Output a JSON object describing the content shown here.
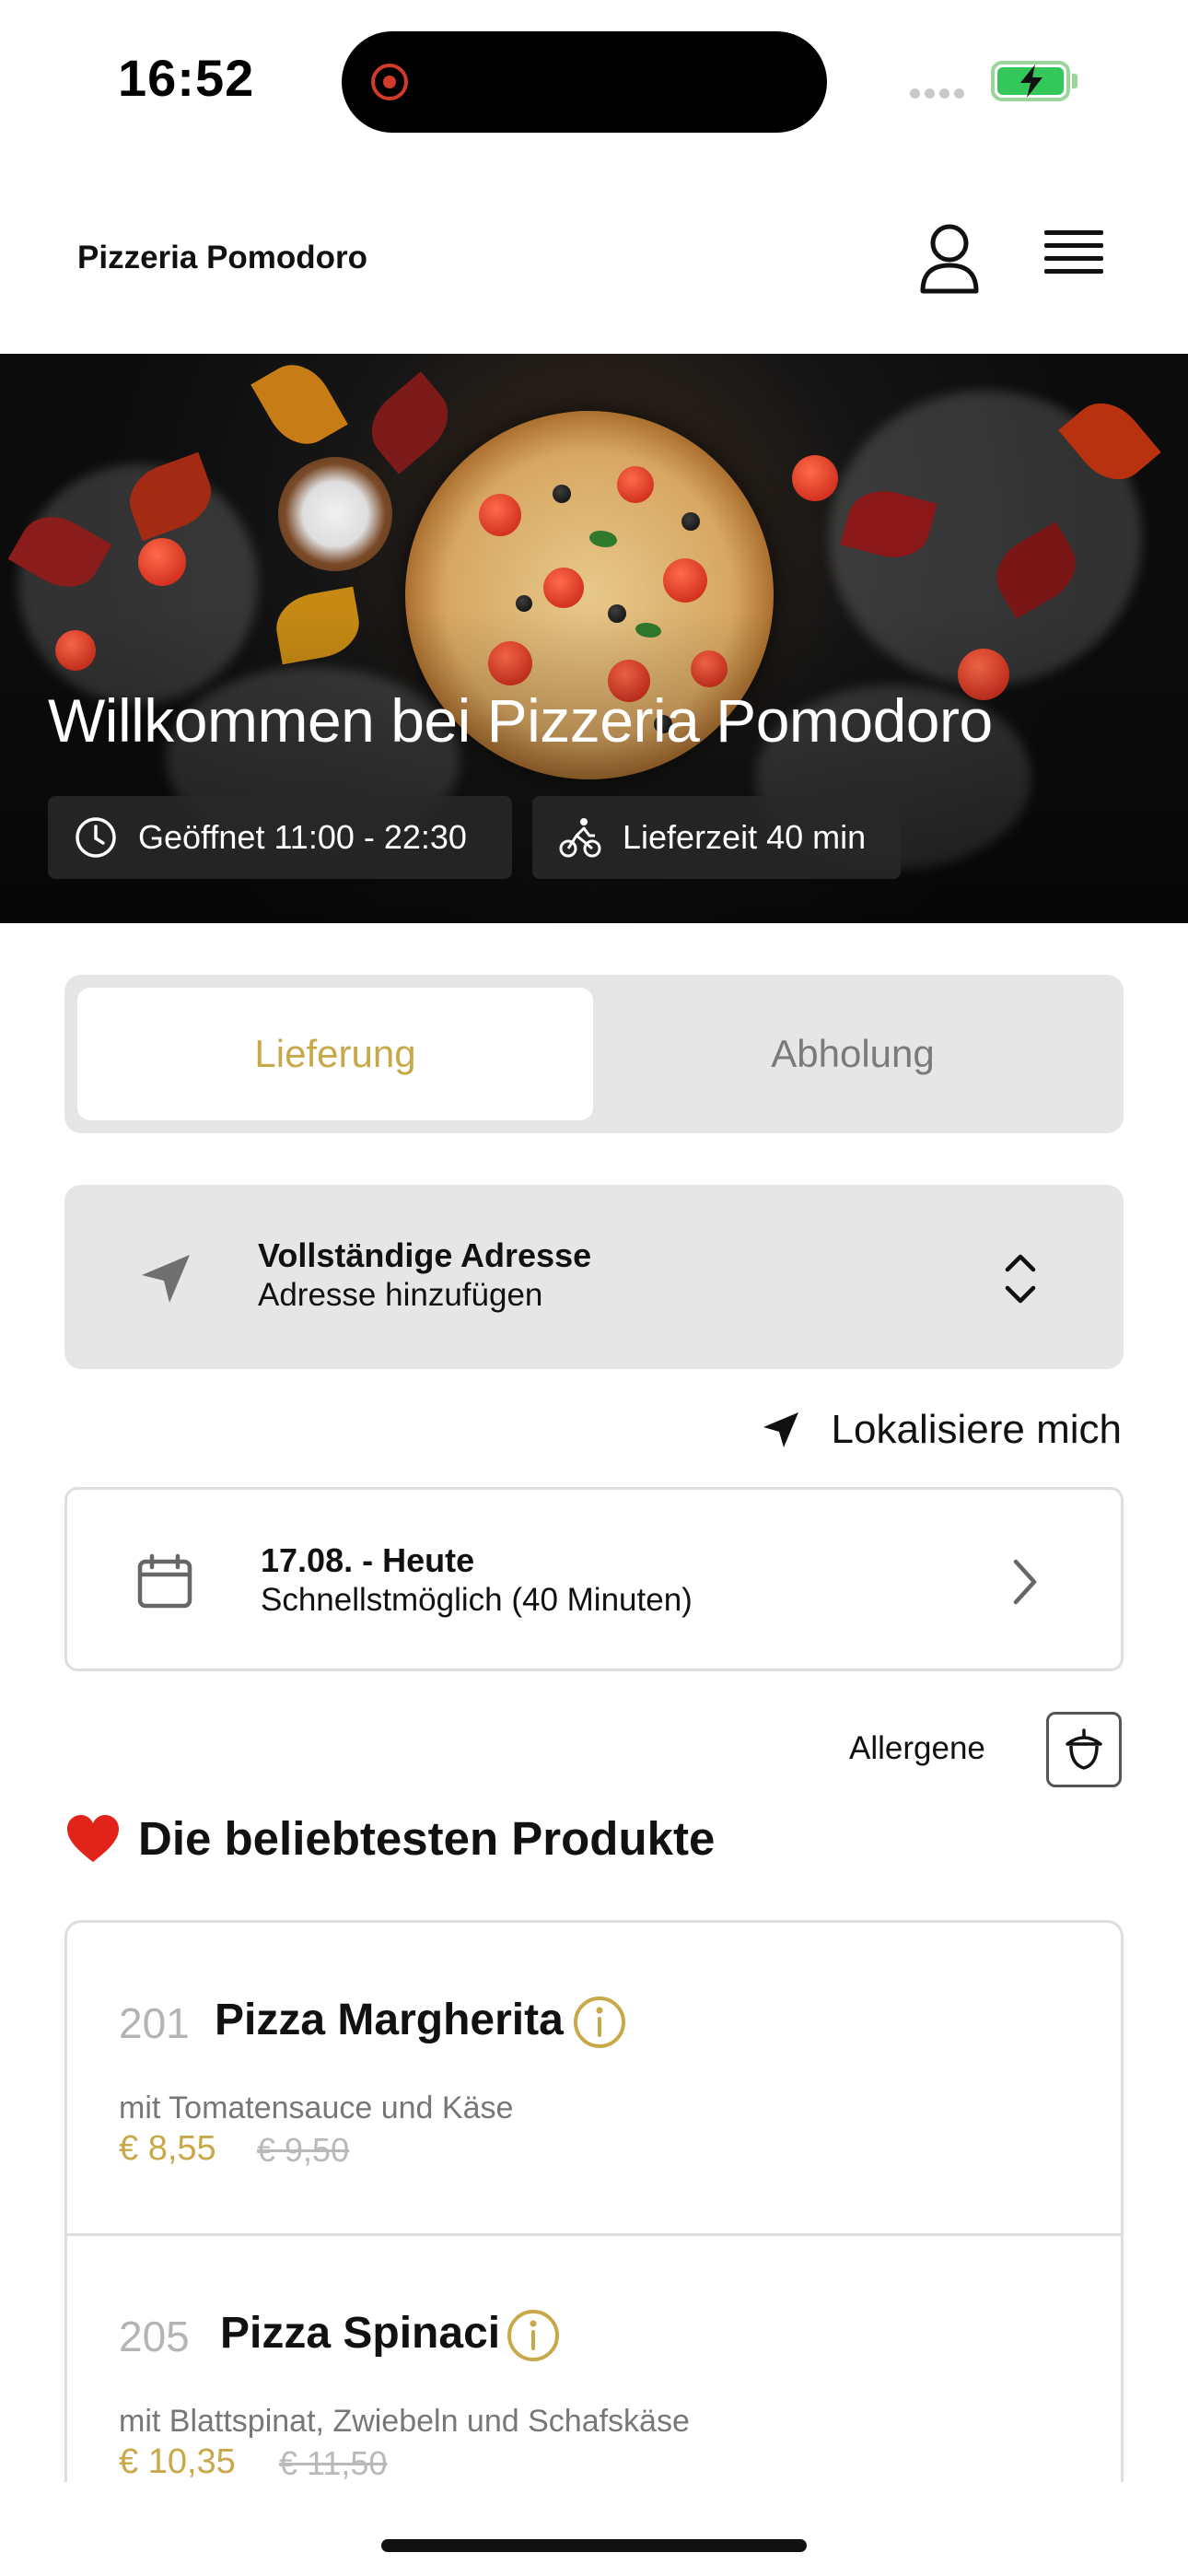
{
  "status_bar": {
    "time": "16:52"
  },
  "header": {
    "brand": "Pizzeria Pomodoro"
  },
  "hero": {
    "title": "Willkommen bei Pizzeria Pomodoro",
    "hours": "Geöffnet 11:00 - 22:30",
    "delivery_time": "Lieferzeit 40 min"
  },
  "tabs": [
    {
      "label": "Lieferung",
      "active": true
    },
    {
      "label": "Abholung",
      "active": false
    }
  ],
  "address": {
    "title": "Vollständige Adresse",
    "subtitle": "Adresse hinzufügen"
  },
  "locate": {
    "label": "Lokalisiere mich"
  },
  "date": {
    "title": "17.08. - Heute",
    "subtitle": "Schnellstmöglich (40 Minuten)"
  },
  "allergens": {
    "label": "Allergene"
  },
  "section": {
    "title": "Die beliebtesten Produkte"
  },
  "products": [
    {
      "number": "201",
      "name": "Pizza Margherita",
      "description": "mit Tomatensauce und Käse",
      "price": "€ 8,55",
      "old_price": "€ 9,50"
    },
    {
      "number": "205",
      "name": "Pizza Spinaci",
      "description": "mit Blattspinat, Zwiebeln und Schafskäse",
      "price": "€ 10,35",
      "old_price": "€ 11,50"
    }
  ],
  "colors": {
    "accent": "#c9a84a",
    "panel": "#e6e6e6",
    "battery": "#34c759"
  },
  "icons": [
    "record-icon",
    "battery-icon",
    "user-icon",
    "menu-icon",
    "clock-icon",
    "bicycle-icon",
    "navigation-arrow-icon",
    "chevron-up-down-icon",
    "location-arrow-icon",
    "calendar-icon",
    "chevron-right-icon",
    "acorn-icon",
    "heart-icon",
    "info-icon"
  ]
}
